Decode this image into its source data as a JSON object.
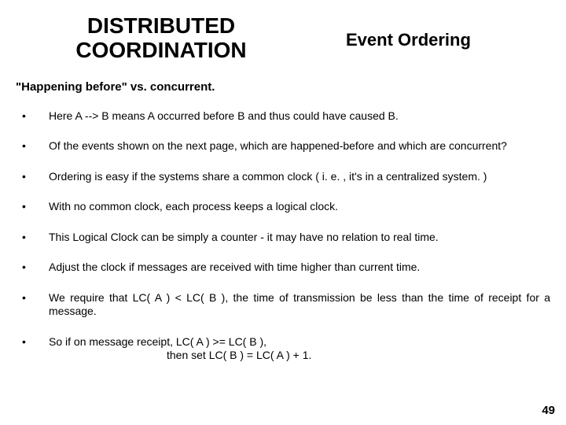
{
  "header": {
    "title_left_line1": "DISTRIBUTED",
    "title_left_line2": "COORDINATION",
    "title_right": "Event Ordering"
  },
  "subheading": "\"Happening before\" vs. concurrent.",
  "bullets": [
    "Here   A --> B   means A occurred before B and  thus could have caused B.",
    "Of the events shown on the next page, which are happened-before and which are concurrent?",
    "Ordering is easy if the systems share a common clock ( i. e. , it's in a centralized system. )",
    "With no common clock, each process keeps a logical clock.",
    "This Logical Clock can be simply a counter - it may have no relation to real time.",
    "Adjust the clock if messages are received with time higher than current time.",
    "We require that LC( A ) < LC( B ),   the time of transmission be less than the time of receipt for a message."
  ],
  "bullet_last_line1": "So if on message receipt,  LC( A ) >= LC( B ),",
  "bullet_last_line2": "then set LC( B ) = LC( A ) + 1.",
  "page_number": "49"
}
